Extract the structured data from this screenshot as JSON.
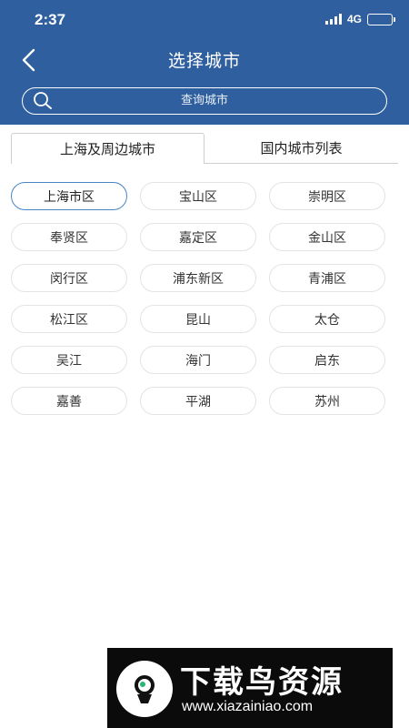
{
  "status_bar": {
    "time": "2:37",
    "network": "4G"
  },
  "nav": {
    "title": "选择城市"
  },
  "search": {
    "placeholder": "查询城市"
  },
  "tabs": [
    {
      "label": "上海及周边城市",
      "active": true
    },
    {
      "label": "国内城市列表",
      "active": false
    }
  ],
  "cities": [
    {
      "label": "上海市区",
      "selected": true
    },
    {
      "label": "宝山区"
    },
    {
      "label": "崇明区"
    },
    {
      "label": "奉贤区"
    },
    {
      "label": "嘉定区"
    },
    {
      "label": "金山区"
    },
    {
      "label": "闵行区"
    },
    {
      "label": "浦东新区"
    },
    {
      "label": "青浦区"
    },
    {
      "label": "松江区"
    },
    {
      "label": "昆山"
    },
    {
      "label": "太仓"
    },
    {
      "label": "吴江"
    },
    {
      "label": "海门"
    },
    {
      "label": "启东"
    },
    {
      "label": "嘉善"
    },
    {
      "label": "平湖"
    },
    {
      "label": "苏州"
    }
  ],
  "watermark": {
    "title": "下载鸟资源",
    "url": "www.xiazainiao.com"
  },
  "colors": {
    "header": "#2f5f9e",
    "selected_border": "#4a86c5"
  },
  "icons": [
    "back-arrow-icon",
    "search-icon",
    "signal-icon",
    "battery-icon",
    "logo-icon"
  ]
}
